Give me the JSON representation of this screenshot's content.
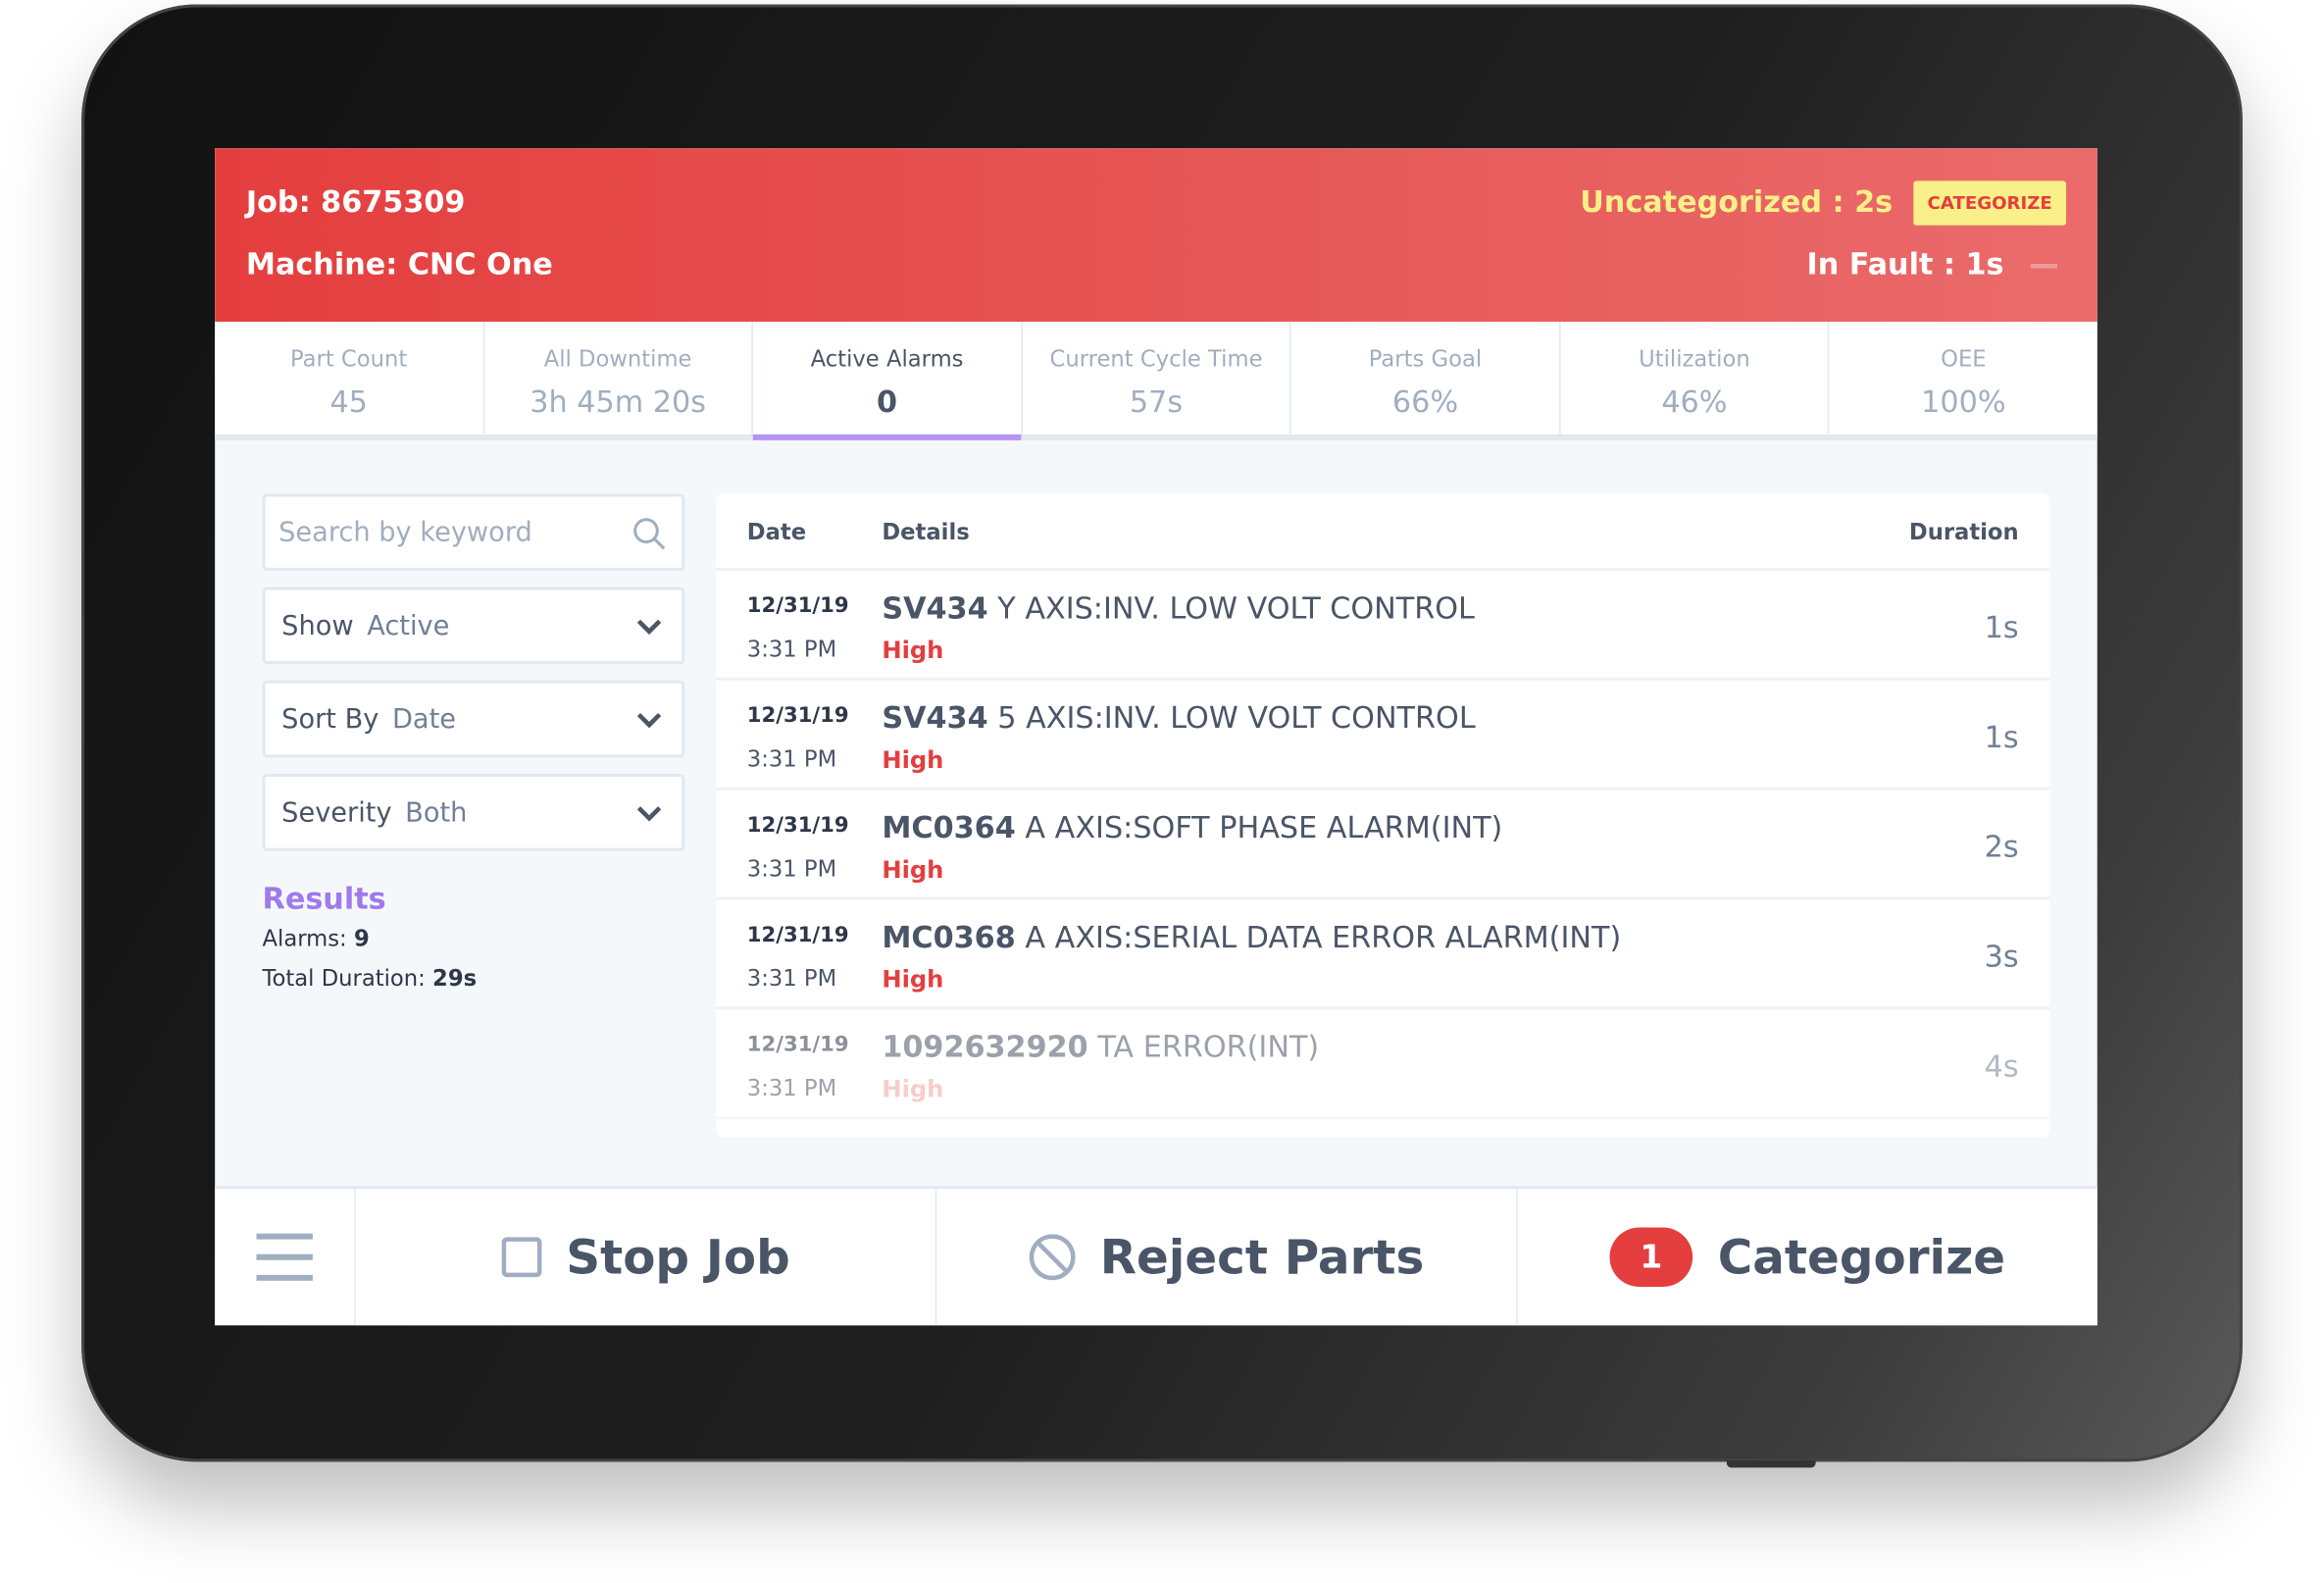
{
  "header": {
    "job": "Job: 8675309",
    "machine": "Machine: CNC One",
    "uncategorized": "Uncategorized : 2s",
    "categorize_btn": "CATEGORIZE",
    "in_fault": "In Fault : 1s"
  },
  "stats": [
    {
      "label": "Part Count",
      "value": "45"
    },
    {
      "label": "All Downtime",
      "value": "3h 45m 20s"
    },
    {
      "label": "Active Alarms",
      "value": "0"
    },
    {
      "label": "Current Cycle Time",
      "value": "57s"
    },
    {
      "label": "Parts Goal",
      "value": "66%"
    },
    {
      "label": "Utilization",
      "value": "46%"
    },
    {
      "label": "OEE",
      "value": "100%"
    }
  ],
  "filters": {
    "search_placeholder": "Search by keyword",
    "show_label": "Show",
    "show_value": "Active",
    "sort_label": "Sort By",
    "sort_value": "Date",
    "severity_label": "Severity",
    "severity_value": "Both"
  },
  "results": {
    "title": "Results",
    "alarms_label": "Alarms:",
    "alarms_value": "9",
    "duration_label": "Total Duration:",
    "duration_value": "29s"
  },
  "table": {
    "headers": {
      "date": "Date",
      "details": "Details",
      "duration": "Duration"
    },
    "rows": [
      {
        "date": "12/31/19",
        "time": "3:31 PM",
        "code": "SV434",
        "desc": "Y AXIS:INV. LOW VOLT CONTROL",
        "severity": "High",
        "duration": "1s"
      },
      {
        "date": "12/31/19",
        "time": "3:31 PM",
        "code": "SV434",
        "desc": "5 AXIS:INV. LOW VOLT CONTROL",
        "severity": "High",
        "duration": "1s"
      },
      {
        "date": "12/31/19",
        "time": "3:31 PM",
        "code": "MC0364",
        "desc": "A AXIS:SOFT PHASE ALARM(INT)",
        "severity": "High",
        "duration": "2s"
      },
      {
        "date": "12/31/19",
        "time": "3:31 PM",
        "code": "MC0368",
        "desc": "A AXIS:SERIAL DATA ERROR ALARM(INT)",
        "severity": "High",
        "duration": "3s"
      },
      {
        "date": "12/31/19",
        "time": "3:31 PM",
        "code": "1092632920",
        "desc": "TA ERROR(INT)",
        "severity": "High",
        "duration": "4s"
      }
    ]
  },
  "bottom": {
    "stop_job": "Stop Job",
    "reject_parts": "Reject Parts",
    "categorize": "Categorize",
    "categorize_count": "1"
  },
  "colors": {
    "header_red": "#e53e3e",
    "accent_yellow": "#faf089",
    "active_tab": "#b794f4",
    "results": "#9f7aea",
    "severity_high": "#e53e3e"
  }
}
